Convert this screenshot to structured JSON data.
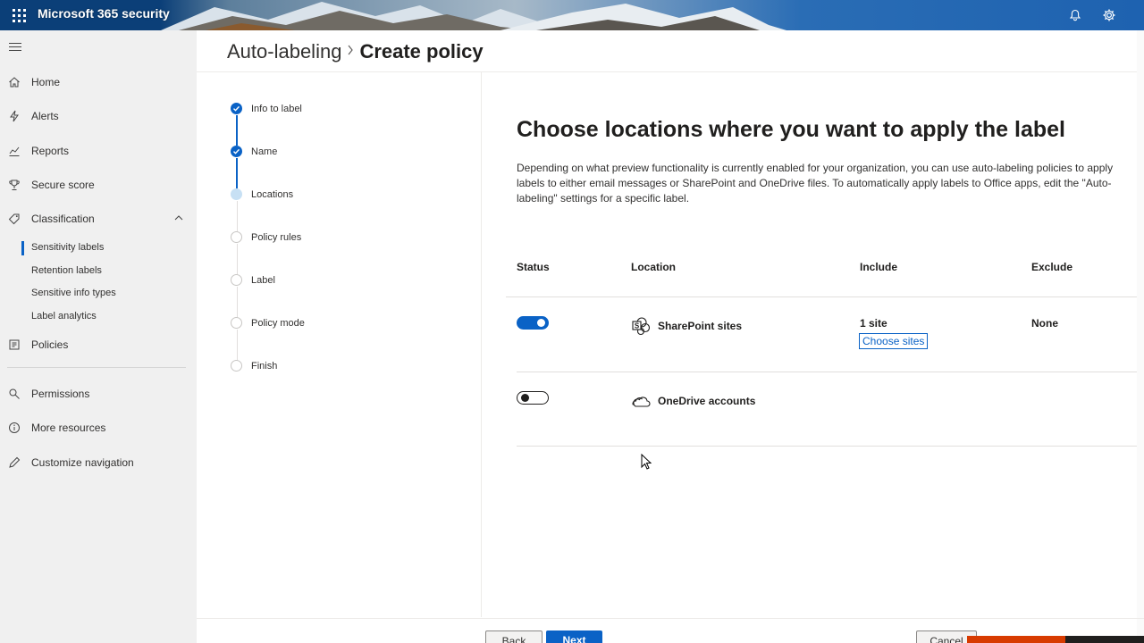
{
  "topbar": {
    "app_title": "Microsoft 365 security",
    "icons": [
      "waffle-icon",
      "bell-icon",
      "gear-icon"
    ]
  },
  "sidebar": {
    "items": [
      {
        "label": "Home",
        "icon": "home-icon"
      },
      {
        "label": "Alerts",
        "icon": "lightning-icon"
      },
      {
        "label": "Reports",
        "icon": "chart-icon"
      },
      {
        "label": "Secure score",
        "icon": "trophy-icon"
      },
      {
        "label": "Classification",
        "icon": "tag-icon"
      },
      {
        "label": "Policies",
        "icon": "policy-icon"
      },
      {
        "label": "Permissions",
        "icon": "search-person-icon"
      },
      {
        "label": "More resources",
        "icon": "info-icon"
      },
      {
        "label": "Customize navigation",
        "icon": "pencil-icon"
      }
    ],
    "classification_subitems": [
      "Sensitivity labels",
      "Retention labels",
      "Sensitive info types",
      "Label analytics"
    ]
  },
  "breadcrumb": {
    "parent": "Auto-labeling",
    "current": "Create policy"
  },
  "steps": [
    {
      "label": "Info to label",
      "state": "done"
    },
    {
      "label": "Name",
      "state": "done"
    },
    {
      "label": "Locations",
      "state": "current"
    },
    {
      "label": "Policy rules",
      "state": "todo"
    },
    {
      "label": "Label",
      "state": "todo"
    },
    {
      "label": "Policy mode",
      "state": "todo"
    },
    {
      "label": "Finish",
      "state": "todo"
    }
  ],
  "main": {
    "title": "Choose locations where you want to apply the label",
    "description_lines": [
      "Depending on what preview functionality is currently enabled for your organization, you can use auto-labeling policies to apply",
      "labels to either email messages or SharePoint and OneDrive files. To automatically apply labels to Office apps, edit the \"Auto-",
      "labeling\" settings for a specific label."
    ],
    "table": {
      "headers": {
        "status": "Status",
        "location": "Location",
        "include": "Include",
        "exclude": "Exclude"
      },
      "rows": [
        {
          "status": "on",
          "location": "SharePoint sites",
          "include": "1 site",
          "include_link": "Choose sites",
          "exclude": "None"
        },
        {
          "status": "off",
          "location": "OneDrive accounts",
          "include": "",
          "exclude": ""
        }
      ]
    }
  },
  "footer": {
    "back_label": "Back",
    "next_label": "Next",
    "cancel_label": "Cancel"
  },
  "colors": {
    "accent": "#0a62c6",
    "sidebar_bg": "#f0f0f0"
  }
}
